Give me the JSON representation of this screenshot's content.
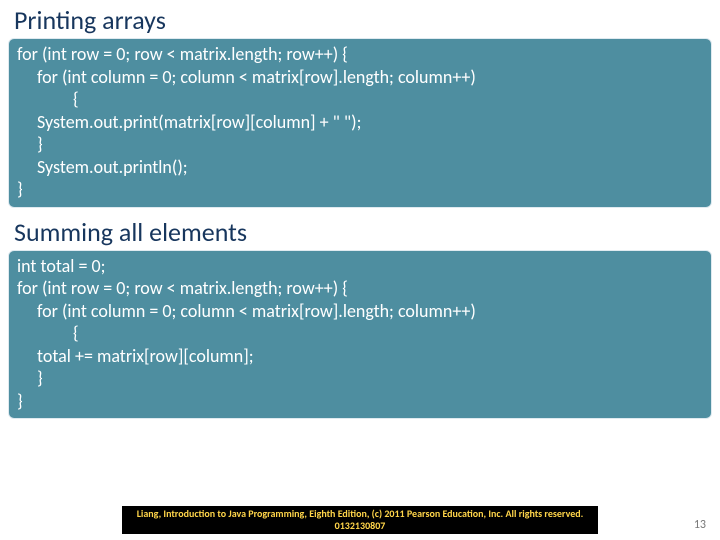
{
  "headings": {
    "h1": "Printing arrays",
    "h2": "Summing all elements"
  },
  "code1": {
    "l1": "for (int row = 0; row < matrix.length; row++) {",
    "l2": "for (int column = 0; column < matrix[row].length; column++)",
    "l3": "{",
    "l4": "System.out.print(matrix[row][column] + \" \");",
    "l5": "}",
    "l6": "System.out.println();",
    "l7": "}"
  },
  "code2": {
    "l1": "int total = 0;",
    "l2": "for (int row = 0; row < matrix.length; row++) {",
    "l3": "for (int column = 0; column < matrix[row].length; column++)",
    "l4": "{",
    "l5": "total += matrix[row][column];",
    "l6": "}",
    "l7": "}"
  },
  "footer": {
    "attribution": "Liang, Introduction to Java Programming, Eighth Edition, (c) 2011 Pearson Education, Inc. All rights reserved. 0132130807",
    "page": "13"
  }
}
